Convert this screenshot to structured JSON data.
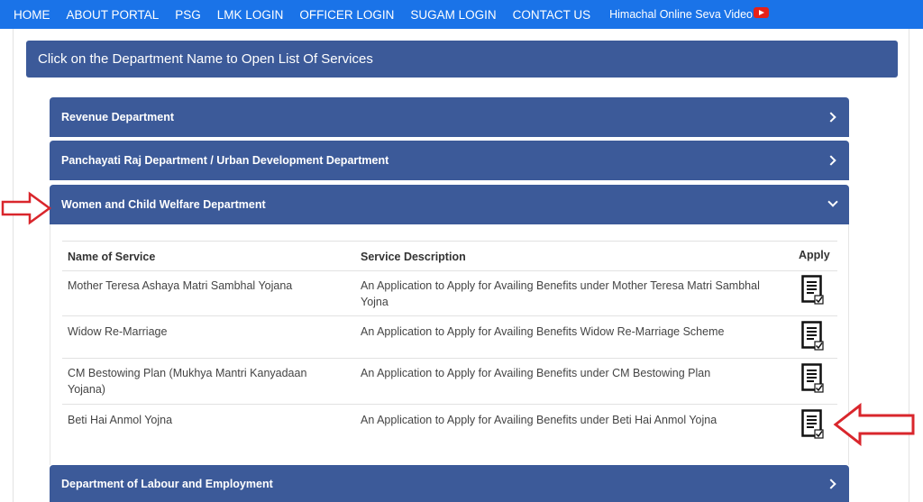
{
  "nav": {
    "items": [
      "HOME",
      "ABOUT PORTAL",
      "PSG",
      "LMK LOGIN",
      "OFFICER LOGIN",
      "SUGAM LOGIN",
      "CONTACT US"
    ],
    "video_label": "Himachal Online Seva Video"
  },
  "banner": "Click on the Department Name to Open List Of Services",
  "departments": [
    "Revenue Department",
    "Panchayati Raj Department / Urban Development Department",
    "Women and Child Welfare Department",
    "Department of Labour and Employment"
  ],
  "table": {
    "headers": {
      "name": "Name of Service",
      "desc": "Service Description",
      "apply": "Apply"
    },
    "rows": [
      {
        "name": "Mother Teresa Ashaya Matri Sambhal Yojana",
        "desc": "An Application to Apply for Availing Benefits under Mother Teresa Matri Sambhal Yojna"
      },
      {
        "name": "Widow Re-Marriage",
        "desc": "An Application to Apply for Availing Benefits Widow Re-Marriage Scheme"
      },
      {
        "name": "CM Bestowing Plan (Mukhya Mantri Kanyadaan Yojana)",
        "desc": "An Application to Apply for Availing Benefits under CM Bestowing Plan"
      },
      {
        "name": "Beti Hai Anmol Yojna",
        "desc": "An Application to Apply for Availing Benefits under Beti Hai Anmol Yojna"
      }
    ]
  },
  "colors": {
    "nav": "#1a73e8",
    "panel": "#3c5a99",
    "arrow": "#d9262c"
  }
}
